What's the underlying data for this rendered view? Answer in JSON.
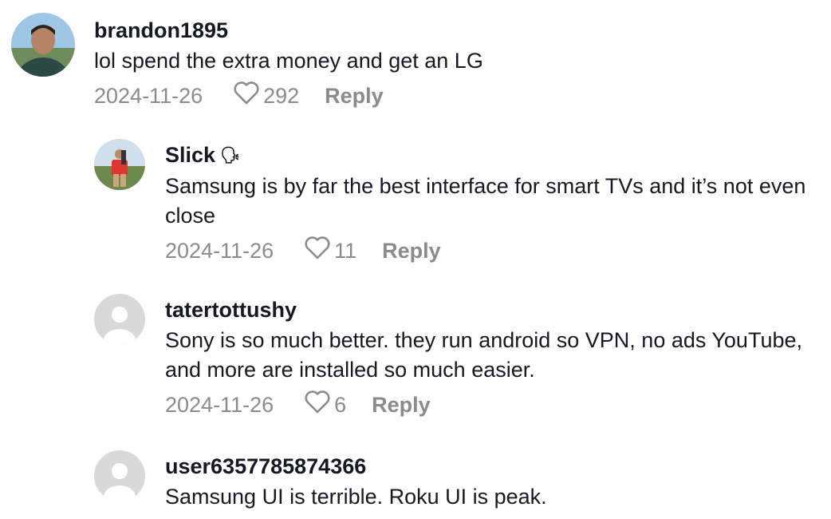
{
  "comments": [
    {
      "username": "brandon1895",
      "text": "lol spend the extra money and get an LG",
      "date": "2024-11-26",
      "likes": "292",
      "reply_label": "Reply"
    },
    {
      "username": "Slick",
      "badge_icon": "speaking-head-icon",
      "text": "Samsung is by far the best interface for smart TVs and it’s not even close",
      "date": "2024-11-26",
      "likes": "11",
      "reply_label": "Reply"
    },
    {
      "username": "tatertottushy",
      "text": "Sony is so much better. they run android so VPN, no ads YouTube, and more are installed so much easier.",
      "date": "2024-11-26",
      "likes": "6",
      "reply_label": "Reply"
    },
    {
      "username": "user6357785874366",
      "text": "Samsung UI is terrible. Roku UI is peak."
    }
  ],
  "colors": {
    "text": "#161823",
    "meta": "#8a8b91",
    "default_avatar_bg": "#d9d9d9"
  }
}
